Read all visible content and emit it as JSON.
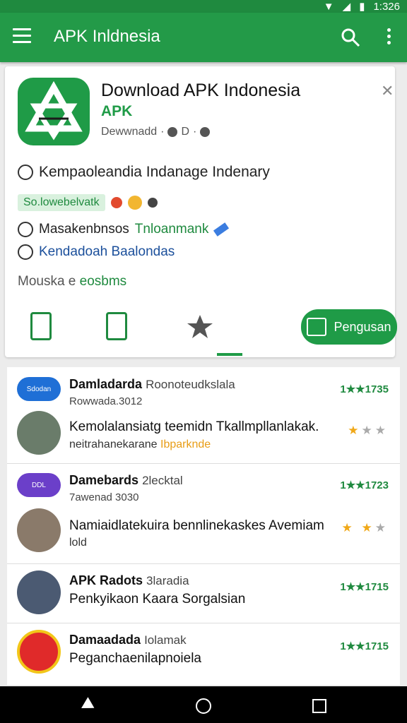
{
  "status": {
    "time": "1:326"
  },
  "appbar": {
    "title": "APK Inldnesia"
  },
  "app": {
    "name": "Download APK Indonesia",
    "sub": "APK",
    "meta_text": "Dewwnadd",
    "meta_sep": "·",
    "meta_d": "D",
    "desc": "Kempaoleandia Indanage Indenary",
    "badge": "So.lowebelvatk",
    "line3a": "Masakenbnsos",
    "line3b": "Tnloanmank",
    "line4": "Kendadoah Baalondas",
    "more_a": "Mouska e",
    "more_b": "eosbms",
    "cta": "Pengusan"
  },
  "list": [
    {
      "name": "Damladarda",
      "cat": "Roonoteudkslala",
      "info": "Rowwada.3012",
      "desc": "Kemolalansiatg teemidn Tkallmpllanlakak.",
      "desc2a": "neitrahanekarane",
      "desc2b": "Ibparknde",
      "rating": "1★★1735",
      "stars_on": "★",
      "stars_off": "★★",
      "icon_text": "Sdodan"
    },
    {
      "name": "Damebards",
      "cat": "2lecktal",
      "info": "7awenad 3030",
      "desc": "Namiaidlatekuira bennlinekaskes Avemiam",
      "desc2a": "lold",
      "desc2b": "",
      "rating": "1★★1723",
      "stars_on": "★ ★",
      "stars_off": "★",
      "icon_text": "DDL"
    },
    {
      "name": "APK Radots",
      "cat": "3laradia",
      "info": "",
      "desc": "Penkyikaon Kaara",
      "desc2a": "Sorgalsian",
      "desc2b": "",
      "rating": "1★★1715",
      "stars_on": "",
      "stars_off": "",
      "icon_text": ""
    },
    {
      "name": "Damaadada",
      "cat": "Iolamak",
      "info": "",
      "desc": "Peganchaenilapnoiela",
      "desc2a": "",
      "desc2b": "",
      "rating": "1★★1715",
      "stars_on": "",
      "stars_off": "",
      "icon_text": ""
    }
  ]
}
